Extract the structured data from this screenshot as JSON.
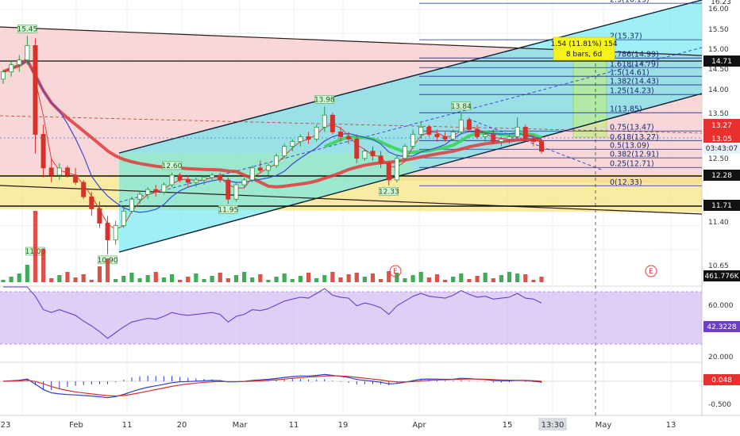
{
  "chart_data": {
    "type": "candlestick",
    "price_axis": {
      "ticks": [
        "16.00",
        "15.50",
        "15.00",
        "14.50",
        "14.00",
        "13.50",
        "13.00",
        "12.50",
        "11.40",
        "10.65"
      ],
      "top_value": "16.23",
      "ylim": [
        10.45,
        16.25
      ],
      "tags": {
        "price": "13.27",
        "price_sub": "13.05",
        "countdown": "03:43:07",
        "level_high": "14.71",
        "level_mid": "12.28",
        "level_low": "11.71",
        "volume": "461.776K"
      }
    },
    "time_axis": {
      "labels": [
        "23",
        "Feb",
        "11",
        "20",
        "Mar",
        "11",
        "19",
        "Apr",
        "15",
        "13:30",
        "May",
        "13"
      ],
      "highlight": "13:30"
    },
    "price_levels": {
      "resistance": 14.71,
      "support_upper": 12.28,
      "support_lower": 11.71
    },
    "point_labels": [
      {
        "text": "15.45",
        "value": 15.45
      },
      {
        "text": "11.08",
        "value": 11.08
      },
      {
        "text": "10.90",
        "value": 10.9
      },
      {
        "text": "12.60",
        "value": 12.6
      },
      {
        "text": "11.95",
        "value": 11.95
      },
      {
        "text": "13.98",
        "value": 13.98
      },
      {
        "text": "12.33",
        "value": 12.33
      },
      {
        "text": "13.84",
        "value": 13.84
      }
    ],
    "fib_levels": [
      {
        "label": "2.5(16.13)",
        "value": 16.13
      },
      {
        "label": "2(15.37)",
        "value": 15.37
      },
      {
        "label": "1.786(14.99)",
        "value": 14.99
      },
      {
        "label": "1.618(14.79)",
        "value": 14.79
      },
      {
        "label": "1.5(14.61)",
        "value": 14.61
      },
      {
        "label": "1.382(14.43)",
        "value": 14.43
      },
      {
        "label": "1.25(14.23)",
        "value": 14.23
      },
      {
        "label": "1(13.85)",
        "value": 13.85
      },
      {
        "label": "0.75(13.47)",
        "value": 13.47
      },
      {
        "label": "0.618(13.27)",
        "value": 13.27
      },
      {
        "label": "0.5(13.09)",
        "value": 13.09
      },
      {
        "label": "0.382(12.91)",
        "value": 12.91
      },
      {
        "label": "0.25(12.71)",
        "value": 12.71
      },
      {
        "label": "0(12.33)",
        "value": 12.33
      }
    ],
    "projection": {
      "line1": "1.54 (11.81%) 154",
      "line2": "8 bars, 6d"
    },
    "events": [
      "E",
      "E"
    ],
    "candles": [
      [
        14.55,
        14.75,
        14.45,
        14.7
      ],
      [
        14.7,
        14.95,
        14.6,
        14.85
      ],
      [
        14.85,
        15.05,
        14.7,
        14.95
      ],
      [
        14.95,
        15.45,
        14.85,
        15.25
      ],
      [
        15.25,
        15.4,
        13.0,
        13.4
      ],
      [
        13.4,
        13.6,
        12.5,
        12.7
      ],
      [
        12.7,
        12.9,
        12.4,
        12.55
      ],
      [
        12.55,
        12.8,
        12.45,
        12.7
      ],
      [
        12.7,
        12.75,
        12.5,
        12.55
      ],
      [
        12.55,
        12.7,
        12.35,
        12.4
      ],
      [
        12.4,
        12.45,
        12.05,
        12.1
      ],
      [
        12.1,
        12.2,
        11.7,
        11.85
      ],
      [
        11.85,
        12.0,
        11.45,
        11.55
      ],
      [
        11.55,
        11.7,
        10.9,
        11.2
      ],
      [
        11.2,
        11.6,
        11.1,
        11.5
      ],
      [
        11.5,
        11.9,
        11.45,
        11.8
      ],
      [
        11.8,
        12.1,
        11.75,
        12.05
      ],
      [
        12.05,
        12.2,
        11.95,
        12.15
      ],
      [
        12.15,
        12.3,
        12.05,
        12.25
      ],
      [
        12.25,
        12.35,
        12.1,
        12.2
      ],
      [
        12.2,
        12.4,
        12.15,
        12.35
      ],
      [
        12.35,
        12.6,
        12.3,
        12.55
      ],
      [
        12.55,
        12.6,
        12.4,
        12.45
      ],
      [
        12.45,
        12.55,
        12.3,
        12.4
      ],
      [
        12.4,
        12.5,
        12.3,
        12.45
      ],
      [
        12.45,
        12.55,
        12.35,
        12.5
      ],
      [
        12.5,
        12.6,
        12.45,
        12.55
      ],
      [
        12.55,
        12.6,
        12.4,
        12.45
      ],
      [
        12.45,
        12.5,
        11.95,
        12.05
      ],
      [
        12.05,
        12.4,
        12.0,
        12.35
      ],
      [
        12.35,
        12.5,
        12.3,
        12.45
      ],
      [
        12.45,
        12.75,
        12.4,
        12.7
      ],
      [
        12.7,
        12.85,
        12.6,
        12.65
      ],
      [
        12.65,
        12.8,
        12.55,
        12.75
      ],
      [
        12.75,
        13.0,
        12.7,
        12.95
      ],
      [
        12.95,
        13.2,
        12.9,
        13.15
      ],
      [
        13.15,
        13.3,
        13.05,
        13.25
      ],
      [
        13.25,
        13.4,
        13.15,
        13.35
      ],
      [
        13.35,
        13.45,
        13.2,
        13.3
      ],
      [
        13.3,
        13.6,
        13.25,
        13.55
      ],
      [
        13.55,
        13.98,
        13.45,
        13.8
      ],
      [
        13.8,
        13.85,
        13.4,
        13.45
      ],
      [
        13.45,
        13.55,
        13.25,
        13.35
      ],
      [
        13.35,
        13.45,
        13.2,
        13.3
      ],
      [
        13.3,
        13.4,
        12.8,
        12.9
      ],
      [
        12.9,
        13.1,
        12.85,
        13.05
      ],
      [
        13.05,
        13.15,
        12.85,
        12.95
      ],
      [
        12.95,
        13.05,
        12.7,
        12.8
      ],
      [
        12.8,
        12.85,
        12.33,
        12.45
      ],
      [
        12.45,
        12.95,
        12.4,
        12.9
      ],
      [
        12.9,
        13.2,
        12.85,
        13.15
      ],
      [
        13.15,
        13.5,
        13.1,
        13.4
      ],
      [
        13.4,
        13.65,
        13.3,
        13.55
      ],
      [
        13.55,
        13.6,
        13.35,
        13.4
      ],
      [
        13.4,
        13.5,
        13.25,
        13.35
      ],
      [
        13.35,
        13.45,
        13.25,
        13.3
      ],
      [
        13.3,
        13.5,
        13.25,
        13.45
      ],
      [
        13.45,
        13.84,
        13.4,
        13.7
      ],
      [
        13.7,
        13.75,
        13.45,
        13.5
      ],
      [
        13.5,
        13.6,
        13.3,
        13.35
      ],
      [
        13.35,
        13.45,
        13.25,
        13.4
      ],
      [
        13.4,
        13.5,
        13.2,
        13.25
      ],
      [
        13.25,
        13.35,
        13.15,
        13.3
      ],
      [
        13.3,
        13.4,
        13.2,
        13.35
      ],
      [
        13.35,
        13.75,
        13.3,
        13.55
      ],
      [
        13.55,
        13.6,
        13.25,
        13.3
      ],
      [
        13.3,
        13.35,
        13.15,
        13.25
      ],
      [
        13.25,
        13.3,
        13.0,
        13.05
      ]
    ],
    "rsi_axis": {
      "ticks": [
        "60.000",
        "20.000"
      ],
      "tag": "42.3228"
    },
    "macd_axis": {
      "ticks": [
        "-0.500"
      ],
      "tag": "0.048"
    }
  }
}
